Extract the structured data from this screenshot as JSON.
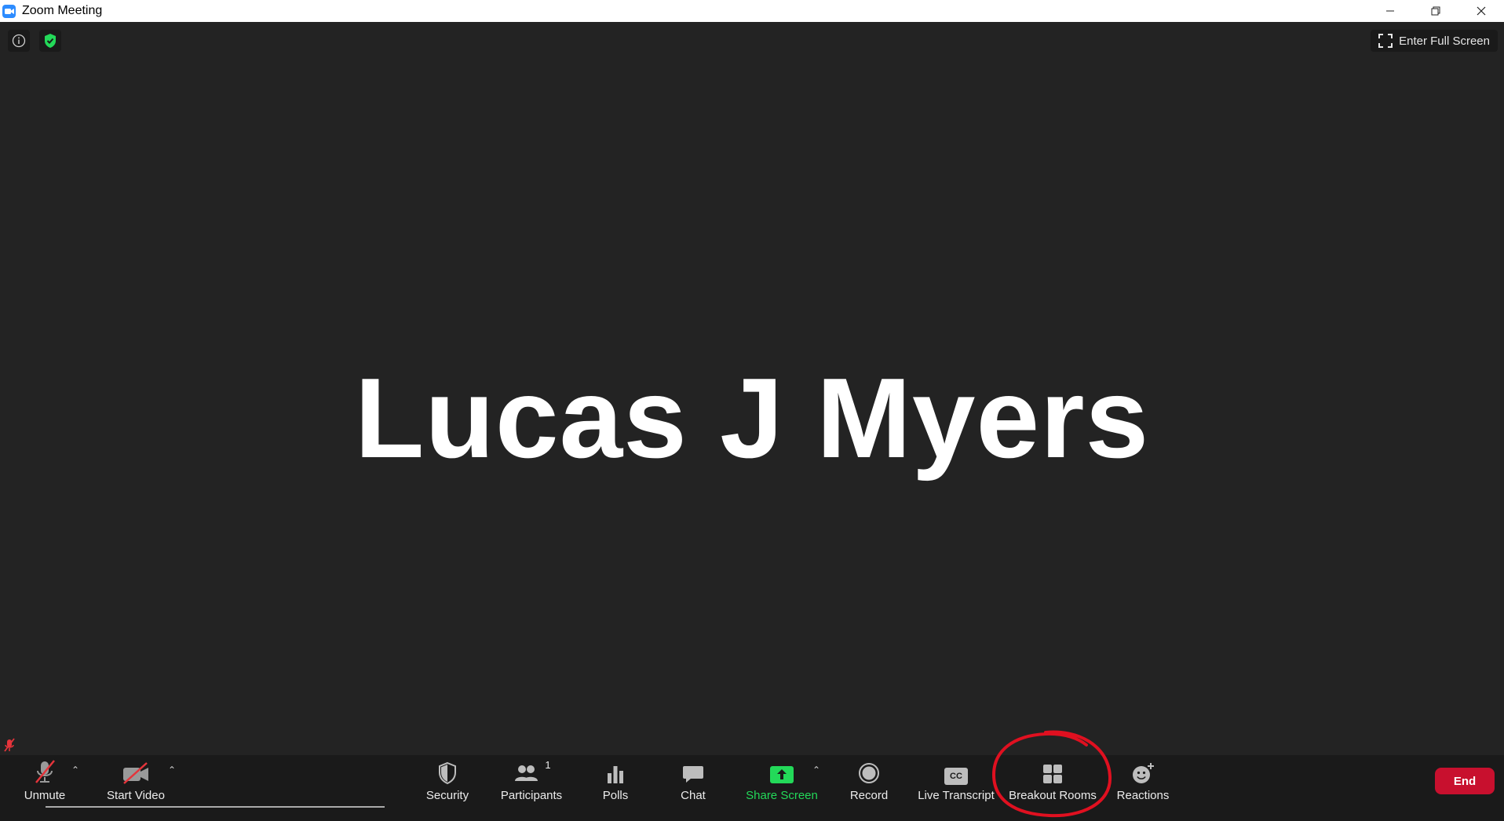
{
  "window": {
    "title": "Zoom Meeting",
    "app_icon": "zoom-camera-icon",
    "controls": [
      "minimize-icon",
      "restore-icon",
      "close-icon"
    ]
  },
  "top_bar": {
    "info_icon": "info-icon",
    "security_status_icon": "shield-check-icon",
    "fullscreen_label": "Enter Full Screen"
  },
  "stage": {
    "participant_name": "Lucas J Myers",
    "mic_status_icon": "muted-mic-icon"
  },
  "toolbar": {
    "unmute": "Unmute",
    "start_video": "Start Video",
    "security": "Security",
    "participants": "Participants",
    "participants_count": "1",
    "polls": "Polls",
    "chat": "Chat",
    "share_screen": "Share Screen",
    "record": "Record",
    "live_transcript": "Live Transcript",
    "live_transcript_badge": "CC",
    "breakout_rooms": "Breakout Rooms",
    "reactions": "Reactions",
    "end": "End"
  },
  "colors": {
    "background": "#232323",
    "toolbar": "#1a1a1a",
    "share_green": "#23d959",
    "end_red": "#c8102e",
    "annotation_red": "#e01020",
    "muted_red": "#e5343b"
  }
}
